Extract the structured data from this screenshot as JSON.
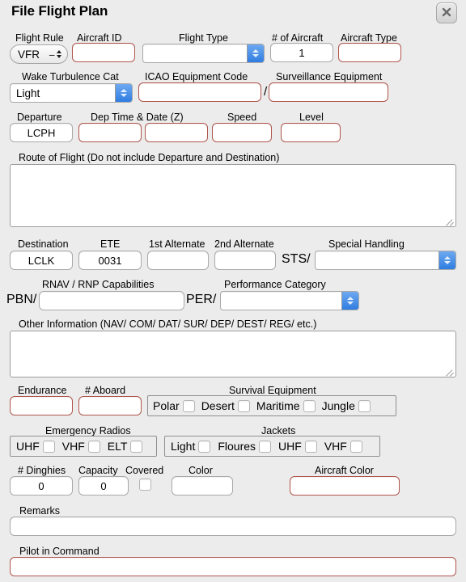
{
  "window": {
    "title": "File Flight Plan",
    "close_icon": "close-icon"
  },
  "fields": {
    "flight_rule": {
      "label": "Flight Rule",
      "value": "VFR",
      "dash": "--"
    },
    "aircraft_id": {
      "label": "Aircraft ID",
      "value": ""
    },
    "flight_type": {
      "label": "Flight Type",
      "value": ""
    },
    "num_aircraft": {
      "label": "# of Aircraft",
      "value": "1"
    },
    "aircraft_type": {
      "label": "Aircraft Type",
      "value": ""
    },
    "wake_turbulence": {
      "label": "Wake Turbulence Cat",
      "value": "Light"
    },
    "icao_equipment": {
      "label": "ICAO Equipment Code",
      "value": ""
    },
    "surveillance": {
      "label": "Surveillance Equipment",
      "value": ""
    },
    "equip_separator": "/",
    "departure": {
      "label": "Departure",
      "value": "LCPH"
    },
    "dep_time_date": {
      "label": "Dep Time & Date (Z)",
      "time_value": "",
      "date_value": ""
    },
    "speed": {
      "label": "Speed",
      "value": ""
    },
    "level": {
      "label": "Level",
      "value": ""
    },
    "route": {
      "label": "Route of Flight (Do not include Departure and Destination)",
      "value": ""
    },
    "destination": {
      "label": "Destination",
      "value": "LCLK"
    },
    "ete": {
      "label": "ETE",
      "value": "0031"
    },
    "alternate_1": {
      "label": "1st Alternate",
      "value": ""
    },
    "alternate_2": {
      "label": "2nd Alternate",
      "value": ""
    },
    "special_handling": {
      "label": "Special Handling",
      "prefix": "STS/",
      "value": ""
    },
    "rnav": {
      "label": "RNAV / RNP Capabilities",
      "prefix": "PBN/",
      "value": ""
    },
    "performance": {
      "label": "Performance Category",
      "prefix": "PER/",
      "value": ""
    },
    "other_info": {
      "label": "Other Information (NAV/ COM/ DAT/ SUR/ DEP/ DEST/ REG/ etc.)",
      "value": ""
    },
    "endurance": {
      "label": "Endurance",
      "value": ""
    },
    "num_aboard": {
      "label": "# Aboard",
      "value": ""
    },
    "num_dinghies": {
      "label": "# Dinghies",
      "value": "0"
    },
    "capacity": {
      "label": "Capacity",
      "value": "0"
    },
    "covered": {
      "label": "Covered",
      "checked": false
    },
    "dinghy_color": {
      "label": "Color",
      "value": ""
    },
    "aircraft_color": {
      "label": "Aircraft Color",
      "value": ""
    },
    "remarks": {
      "label": "Remarks",
      "value": ""
    },
    "pilot_in_command": {
      "label": "Pilot in Command",
      "value": ""
    }
  },
  "groups": {
    "survival_equipment": {
      "label": "Survival Equipment",
      "items": [
        {
          "label": "Polar",
          "checked": false
        },
        {
          "label": "Desert",
          "checked": false
        },
        {
          "label": "Maritime",
          "checked": false
        },
        {
          "label": "Jungle",
          "checked": false
        }
      ]
    },
    "emergency_radios": {
      "label": "Emergency Radios",
      "items": [
        {
          "label": "UHF",
          "checked": false
        },
        {
          "label": "VHF",
          "checked": false
        },
        {
          "label": "ELT",
          "checked": false
        }
      ]
    },
    "jackets": {
      "label": "Jackets",
      "items": [
        {
          "label": "Light",
          "checked": false
        },
        {
          "label": "Floures",
          "checked": false
        },
        {
          "label": "UHF",
          "checked": false
        },
        {
          "label": "VHF",
          "checked": false
        }
      ]
    }
  },
  "colors": {
    "background": "#ececec",
    "required_border": "#b0564c",
    "optional_border": "#a9a9a9",
    "popup_button": "#2f7de1"
  }
}
